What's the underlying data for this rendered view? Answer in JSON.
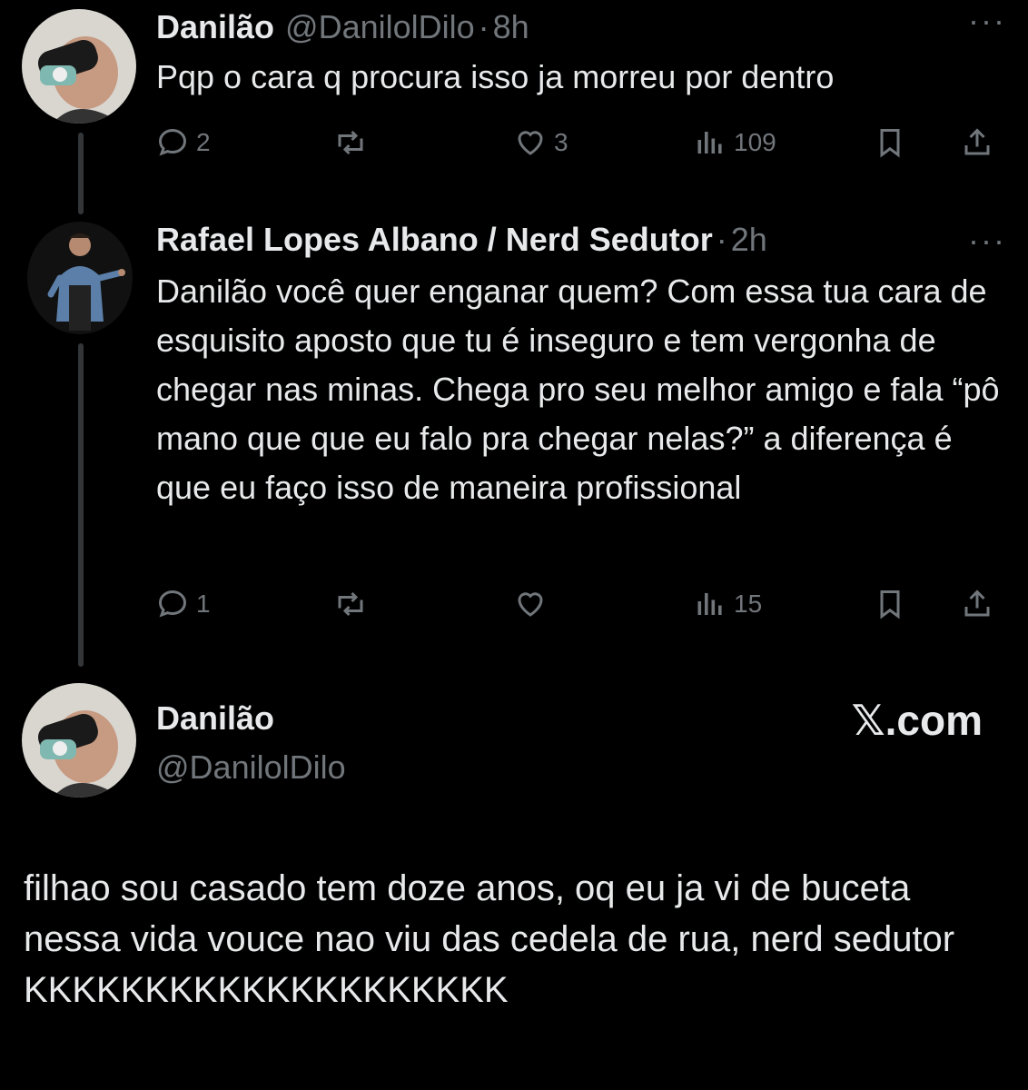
{
  "tweet1": {
    "name": "Danilão",
    "handle": "@DanilolDilo",
    "dot": "·",
    "time": "8h",
    "more": "···",
    "text": "Pqp o cara q procura isso ja morreu por dentro",
    "replies": "2",
    "retweets": "",
    "likes": "3",
    "views": "109"
  },
  "tweet2": {
    "name": "Rafael Lopes Albano / Nerd Sedutor",
    "dot": "·",
    "time": "2h",
    "more": "···",
    "text": "Danilão você quer enganar quem? Com essa tua cara de esquisito aposto que tu é inseguro e tem vergonha de chegar nas minas. Chega pro seu melhor amigo e fala “pô mano que que eu falo pra chegar nelas?” a diferença é que eu faço isso de maneira profissional",
    "replies": "1",
    "retweets": "",
    "likes": "",
    "views": "15"
  },
  "tweet3": {
    "name": "Danilão",
    "handle": "@DanilolDilo",
    "brand": "𝕏.com",
    "text": "filhao sou casado tem doze anos, oq eu ja vi de buceta nessa vida vouce nao viu das cedela de rua, nerd sedutor KKKKKKKKKKKKKKKKKKKK"
  },
  "colors": {
    "background": "#000000",
    "text": "#e7e9ea",
    "muted": "#71767b",
    "thread_line": "#333639"
  },
  "icons": [
    "reply-icon",
    "retweet-icon",
    "like-icon",
    "views-icon",
    "bookmark-icon",
    "share-icon",
    "more-icon"
  ]
}
